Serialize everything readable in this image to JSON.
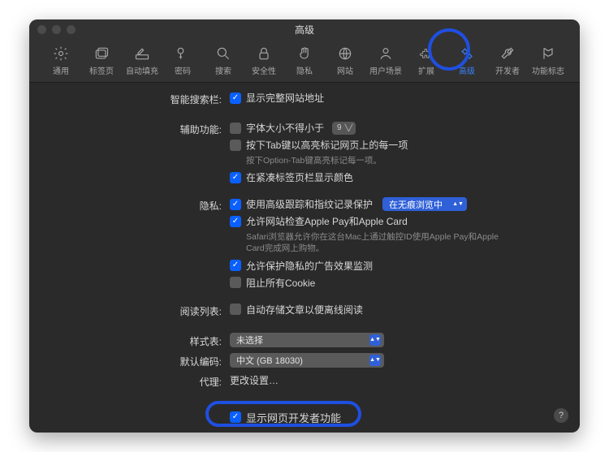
{
  "window": {
    "title": "高级"
  },
  "toolbar": [
    {
      "name": "general",
      "label": "通用"
    },
    {
      "name": "tabs",
      "label": "标签页"
    },
    {
      "name": "autofill",
      "label": "自动填充"
    },
    {
      "name": "passwords",
      "label": "密码"
    },
    {
      "name": "search",
      "label": "搜索"
    },
    {
      "name": "security",
      "label": "安全性"
    },
    {
      "name": "privacy",
      "label": "隐私"
    },
    {
      "name": "websites",
      "label": "网站"
    },
    {
      "name": "profiles",
      "label": "用户场景"
    },
    {
      "name": "extensions",
      "label": "扩展"
    },
    {
      "name": "advanced",
      "label": "高级",
      "active": true
    },
    {
      "name": "developer",
      "label": "开发者"
    },
    {
      "name": "flags",
      "label": "功能标志"
    }
  ],
  "sections": {
    "smartSearch": {
      "label": "智能搜索栏:",
      "showFullAddress": "显示完整网站地址"
    },
    "accessibility": {
      "label": "辅助功能:",
      "minFont": "字体大小不得小于",
      "minFontValue": "9",
      "tabHighlight": "按下Tab键以高亮标记网页上的每一项",
      "tabHint": "按下Option-Tab键高亮标记每一项。",
      "compactColor": "在紧凑标签页栏显示颜色"
    },
    "privacy": {
      "label": "隐私:",
      "tracking": "使用高级跟踪和指纹记录保护",
      "trackingMode": "在无痕浏览中",
      "applePay": "允许网站检查Apple Pay和Apple Card",
      "applePayHint": "Safari浏览器允许你在这台Mac上通过触控ID使用Apple Pay和Apple Card完成网上购物。",
      "adMeasure": "允许保护隐私的广告效果监测",
      "blockCookies": "阻止所有Cookie"
    },
    "readingList": {
      "label": "阅读列表:",
      "autoSave": "自动存储文章以便离线阅读"
    },
    "stylesheet": {
      "label": "样式表:",
      "value": "未选择"
    },
    "encoding": {
      "label": "默认编码:",
      "value": "中文 (GB 18030)"
    },
    "proxy": {
      "label": "代理:",
      "link": "更改设置…"
    },
    "devMenu": {
      "label": "显示网页开发者功能"
    }
  }
}
